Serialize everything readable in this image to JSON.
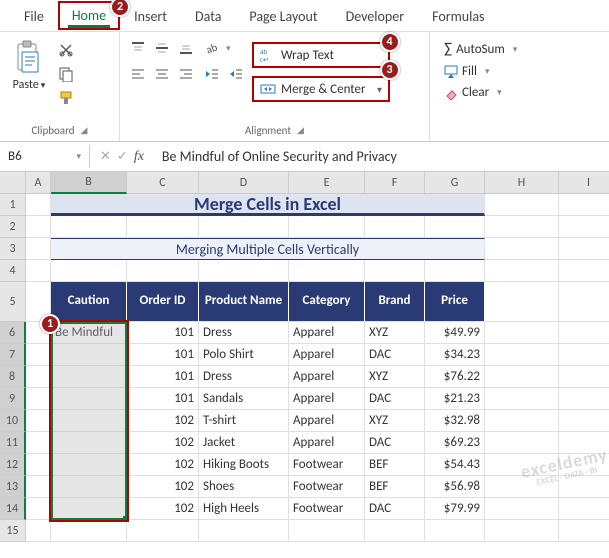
{
  "tabs": {
    "file": "File",
    "home": "Home",
    "insert": "Insert",
    "data": "Data",
    "page_layout": "Page Layout",
    "developer": "Developer",
    "formulas": "Formulas"
  },
  "ribbon": {
    "clipboard": {
      "paste": "Paste",
      "label": "Clipboard"
    },
    "alignment": {
      "wrap": "Wrap Text",
      "merge": "Merge & Center",
      "label": "Alignment"
    },
    "editing": {
      "autosum": "AutoSum",
      "fill": "Fill",
      "clear": "Clear"
    }
  },
  "formula_bar": {
    "name_box": "B6",
    "formula": "Be Mindful of Online Security and Privacy"
  },
  "badges": {
    "b1": "1",
    "b2": "2",
    "b3": "3",
    "b4": "4"
  },
  "col_letters": [
    "A",
    "B",
    "C",
    "D",
    "E",
    "F",
    "G",
    "H",
    "I"
  ],
  "row_nums": [
    "1",
    "2",
    "3",
    "4",
    "5",
    "6",
    "7",
    "8",
    "9",
    "10",
    "11",
    "12",
    "13",
    "14",
    "15"
  ],
  "sheet": {
    "title": "Merge Cells in Excel",
    "subtitle": "Merging Multiple Cells Vertically",
    "headers": {
      "caution": "Caution",
      "order_id": "Order ID",
      "product": "Product Name",
      "category": "Category",
      "brand": "Brand",
      "price": "Price"
    },
    "caution_text": "Be Mindful",
    "rows": [
      {
        "order": "101",
        "product": "Dress",
        "category": "Apparel",
        "brand": "XYZ",
        "price": "$49.99"
      },
      {
        "order": "101",
        "product": "Polo Shirt",
        "category": "Apparel",
        "brand": "DAC",
        "price": "$34.23"
      },
      {
        "order": "101",
        "product": "Dress",
        "category": "Apparel",
        "brand": "XYZ",
        "price": "$76.22"
      },
      {
        "order": "101",
        "product": "Sandals",
        "category": "Apparel",
        "brand": "DAC",
        "price": "$21.23"
      },
      {
        "order": "102",
        "product": "T-shirt",
        "category": "Apparel",
        "brand": "XYZ",
        "price": "$32.98"
      },
      {
        "order": "102",
        "product": "Jacket",
        "category": "Apparel",
        "brand": "DAC",
        "price": "$69.23"
      },
      {
        "order": "102",
        "product": "Hiking Boots",
        "category": "Footwear",
        "brand": "BEF",
        "price": "$54.43"
      },
      {
        "order": "102",
        "product": "Shoes",
        "category": "Footwear",
        "brand": "BEF",
        "price": "$56.98"
      },
      {
        "order": "102",
        "product": "High Heels",
        "category": "Footwear",
        "brand": "DAC",
        "price": "$79.99"
      }
    ]
  },
  "watermark": {
    "main": "exceldemy",
    "sub": "EXCEL · DATA · BI"
  }
}
